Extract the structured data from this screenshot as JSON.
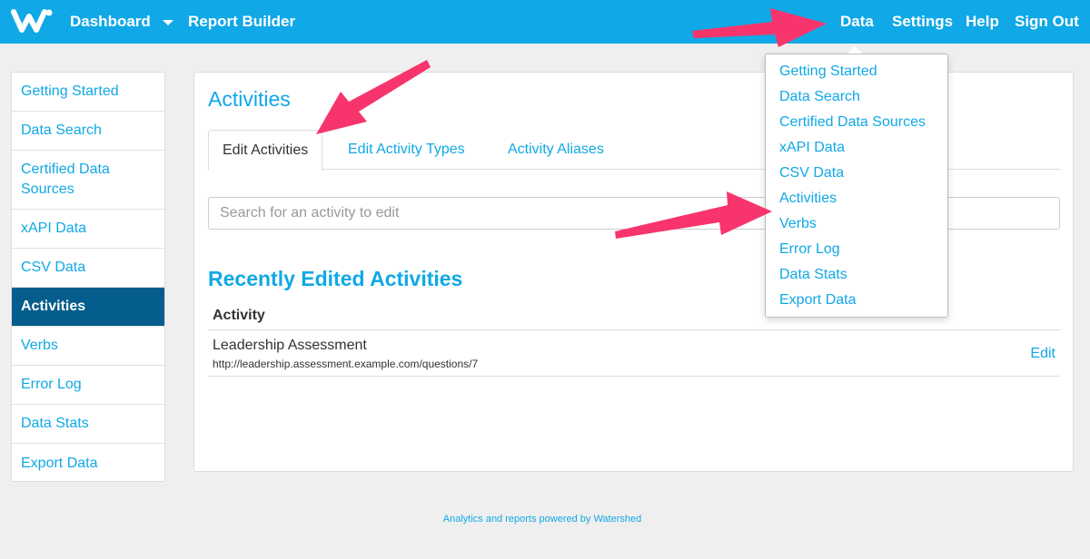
{
  "colors": {
    "brand": "#10a8e6",
    "active_nav": "#045d8c",
    "annotation_arrow": "#f7356c"
  },
  "topnav": {
    "logo_icon": "watershed-w-logo",
    "left": [
      "Dashboard",
      "Report Builder"
    ],
    "right": [
      "Data",
      "Settings",
      "Help",
      "Sign Out"
    ]
  },
  "sidebar": {
    "items": [
      {
        "label": "Getting Started",
        "active": false
      },
      {
        "label": "Data Search",
        "active": false
      },
      {
        "label": "Certified Data Sources",
        "active": false
      },
      {
        "label": "xAPI Data",
        "active": false
      },
      {
        "label": "CSV Data",
        "active": false
      },
      {
        "label": "Activities",
        "active": true
      },
      {
        "label": "Verbs",
        "active": false
      },
      {
        "label": "Error Log",
        "active": false
      },
      {
        "label": "Data Stats",
        "active": false
      },
      {
        "label": "Export Data",
        "active": false
      }
    ]
  },
  "main": {
    "title": "Activities",
    "tabs": [
      {
        "label": "Edit Activities",
        "active": true
      },
      {
        "label": "Edit Activity Types",
        "active": false
      },
      {
        "label": "Activity Aliases",
        "active": false
      }
    ],
    "search_placeholder": "Search for an activity to edit",
    "section_title": "Recently Edited Activities",
    "table": {
      "header": "Activity",
      "rows": [
        {
          "name": "Leadership Assessment",
          "url": "http://leadership.assessment.example.com/questions/7",
          "action": "Edit"
        }
      ]
    }
  },
  "data_dropdown": {
    "items": [
      "Getting Started",
      "Data Search",
      "Certified Data Sources",
      "xAPI Data",
      "CSV Data",
      "Activities",
      "Verbs",
      "Error Log",
      "Data Stats",
      "Export Data"
    ]
  },
  "footer": "Analytics and reports powered by Watershed"
}
